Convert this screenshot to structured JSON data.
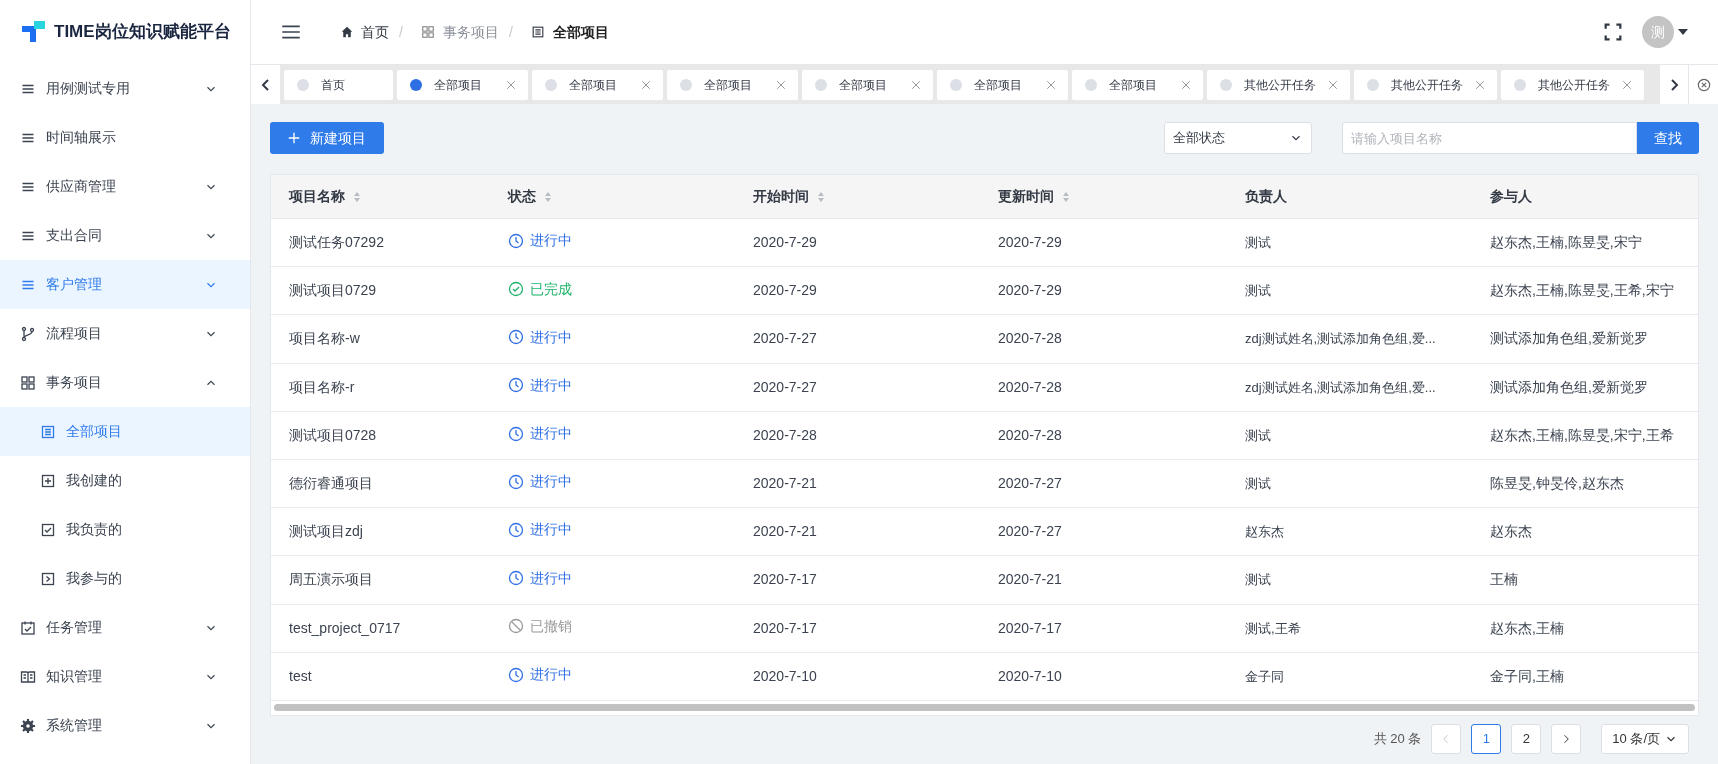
{
  "brand": {
    "title": "TIME岗位知识赋能平台"
  },
  "sidebar": {
    "items": [
      {
        "label": "用例测试专用",
        "selected": false,
        "expanded": false
      },
      {
        "label": "时间轴展示",
        "selected": false
      },
      {
        "label": "供应商管理",
        "selected": false,
        "expanded": false
      },
      {
        "label": "支出合同",
        "selected": false,
        "expanded": false
      },
      {
        "label": "客户管理",
        "selected": true,
        "expanded": false
      },
      {
        "label": "流程项目",
        "selected": false,
        "expanded": false
      },
      {
        "label": "事务项目",
        "selected": false,
        "expanded": true,
        "children": [
          {
            "label": "全部项目",
            "selected": true
          },
          {
            "label": "我创建的",
            "selected": false
          },
          {
            "label": "我负责的",
            "selected": false
          },
          {
            "label": "我参与的",
            "selected": false
          }
        ]
      },
      {
        "label": "任务管理",
        "selected": false,
        "expanded": false
      },
      {
        "label": "知识管理",
        "selected": false,
        "expanded": false
      },
      {
        "label": "系统管理",
        "selected": false,
        "expanded": false
      }
    ]
  },
  "breadcrumb": {
    "separator": "/",
    "items": [
      "首页",
      "事务项目",
      "全部项目"
    ]
  },
  "user": {
    "avatar": "测"
  },
  "tabs": [
    {
      "label": "首页",
      "selected": false,
      "closable": false
    },
    {
      "label": "全部项目",
      "selected": true,
      "closable": true
    },
    {
      "label": "全部项目",
      "selected": false,
      "closable": true
    },
    {
      "label": "全部项目",
      "selected": false,
      "closable": true
    },
    {
      "label": "全部项目",
      "selected": false,
      "closable": true
    },
    {
      "label": "全部项目",
      "selected": false,
      "closable": true
    },
    {
      "label": "全部项目",
      "selected": false,
      "closable": true
    },
    {
      "label": "其他公开任务",
      "selected": false,
      "closable": true
    },
    {
      "label": "其他公开任务",
      "selected": false,
      "closable": true
    },
    {
      "label": "其他公开任务",
      "selected": false,
      "closable": true
    }
  ],
  "toolbar": {
    "new_button": "新建项目",
    "status_filter": "全部状态",
    "search": {
      "placeholder": "请输入项目名称"
    },
    "search_button": "查找"
  },
  "table": {
    "columns": [
      {
        "label": "项目名称",
        "sortable": true
      },
      {
        "label": "状态",
        "sortable": true
      },
      {
        "label": "开始时间",
        "sortable": true
      },
      {
        "label": "更新时间",
        "sortable": true
      },
      {
        "label": "负责人",
        "sortable": false
      },
      {
        "label": "参与人",
        "sortable": false
      }
    ],
    "rows": [
      {
        "name": "测试任务07292",
        "status": {
          "kind": "ongoing",
          "label": "进行中"
        },
        "start": "2020-7-29",
        "updated": "2020-7-29",
        "owner": "测试",
        "participants": "赵东杰,王楠,陈昱旻,宋宁"
      },
      {
        "name": "测试项目0729",
        "status": {
          "kind": "done",
          "label": "已完成"
        },
        "start": "2020-7-29",
        "updated": "2020-7-29",
        "owner": "测试",
        "participants": "赵东杰,王楠,陈昱旻,王希,宋宁"
      },
      {
        "name": "项目名称-w",
        "status": {
          "kind": "ongoing",
          "label": "进行中"
        },
        "start": "2020-7-27",
        "updated": "2020-7-28",
        "owner": "zdj测试姓名,测试添加角色组,爱...",
        "participants": "测试添加角色组,爱新觉罗"
      },
      {
        "name": "项目名称-r",
        "status": {
          "kind": "ongoing",
          "label": "进行中"
        },
        "start": "2020-7-27",
        "updated": "2020-7-28",
        "owner": "zdj测试姓名,测试添加角色组,爱...",
        "participants": "测试添加角色组,爱新觉罗"
      },
      {
        "name": "测试项目0728",
        "status": {
          "kind": "ongoing",
          "label": "进行中"
        },
        "start": "2020-7-28",
        "updated": "2020-7-28",
        "owner": "测试",
        "participants": "赵东杰,王楠,陈昱旻,宋宁,王希"
      },
      {
        "name": "德衍睿通项目",
        "status": {
          "kind": "ongoing",
          "label": "进行中"
        },
        "start": "2020-7-21",
        "updated": "2020-7-27",
        "owner": "测试",
        "participants": "陈昱旻,钟旻伶,赵东杰"
      },
      {
        "name": "测试项目zdj",
        "status": {
          "kind": "ongoing",
          "label": "进行中"
        },
        "start": "2020-7-21",
        "updated": "2020-7-27",
        "owner": "赵东杰",
        "participants": "赵东杰"
      },
      {
        "name": "周五演示项目",
        "status": {
          "kind": "ongoing",
          "label": "进行中"
        },
        "start": "2020-7-17",
        "updated": "2020-7-21",
        "owner": "测试",
        "participants": "王楠"
      },
      {
        "name": "test_project_0717",
        "status": {
          "kind": "cancelled",
          "label": "已撤销"
        },
        "start": "2020-7-17",
        "updated": "2020-7-17",
        "owner": "测试,王希",
        "participants": "赵东杰,王楠"
      },
      {
        "name": "test",
        "status": {
          "kind": "ongoing",
          "label": "进行中"
        },
        "start": "2020-7-10",
        "updated": "2020-7-10",
        "owner": "金子同",
        "participants": "金子同,王楠"
      }
    ]
  },
  "pagination": {
    "total": "共 20 条",
    "pages": [
      {
        "label": "1",
        "selected": true
      },
      {
        "label": "2",
        "selected": false
      }
    ],
    "page_size": "10 条/页"
  }
}
